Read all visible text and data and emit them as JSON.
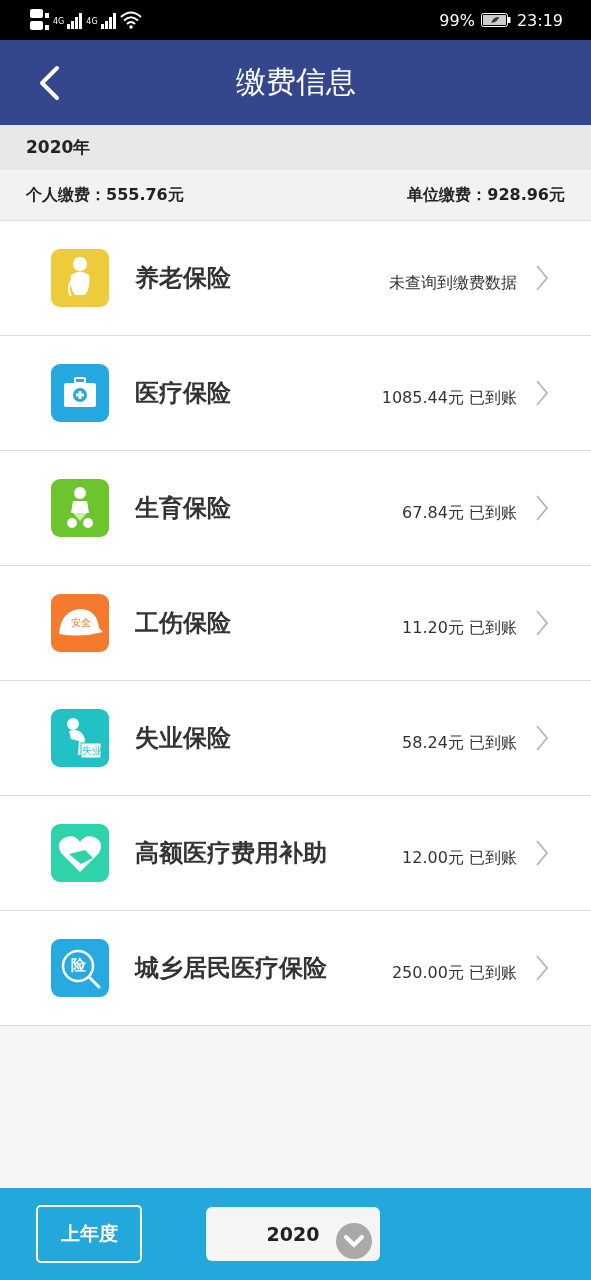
{
  "status_bar": {
    "networks": [
      "4G",
      "4G"
    ],
    "battery": "99%",
    "time": "23:19"
  },
  "header": {
    "title": "缴费信息"
  },
  "year_label": "2020年",
  "summary": {
    "personal": "个人缴费：555.76元",
    "employer": "单位缴费：928.96元"
  },
  "items": [
    {
      "kind": "elder",
      "color": "#eecb3a",
      "name": "养老保险",
      "status": "未查询到缴费数据"
    },
    {
      "kind": "medkit",
      "color": "#25a8e0",
      "name": "医疗保险",
      "status": "1085.44元 已到账"
    },
    {
      "kind": "baby",
      "color": "#6cc52f",
      "name": "生育保险",
      "status": "67.84元 已到账"
    },
    {
      "kind": "helmet",
      "color": "#f47b2e",
      "name": "工伤保险",
      "status": "11.20元 已到账",
      "icon_text": "安全"
    },
    {
      "kind": "jobless",
      "color": "#22c2c4",
      "name": "失业保险",
      "status": "58.24元 已到账",
      "icon_text": "失业"
    },
    {
      "kind": "heart",
      "color": "#2fd3ab",
      "name": "高额医疗费用补助",
      "status": "12.00元 已到账"
    },
    {
      "kind": "search",
      "color": "#27a9e1",
      "name": "城乡居民医疗保险",
      "status": "250.00元 已到账",
      "icon_text": "险"
    }
  ],
  "footer": {
    "prev_button": "上年度",
    "year_select": "2020"
  }
}
